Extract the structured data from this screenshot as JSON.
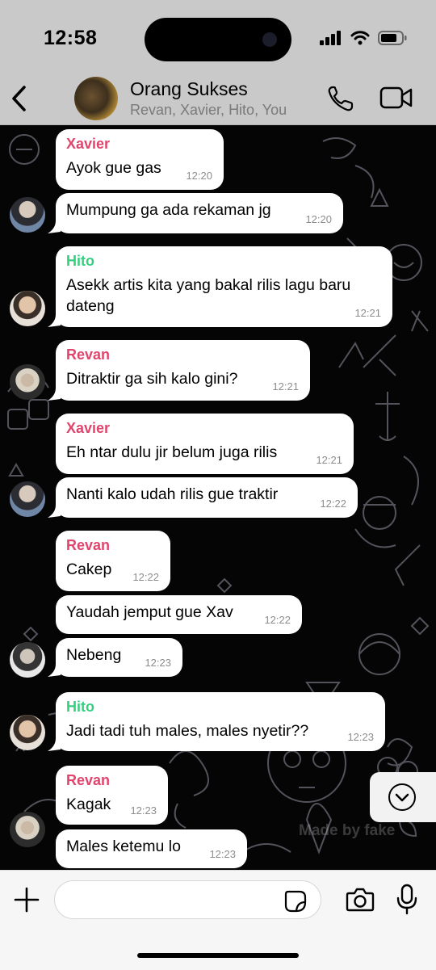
{
  "status_bar": {
    "time": "12:58"
  },
  "header": {
    "group_name": "Orang Sukses",
    "members": "Revan, Xavier, Hito, You"
  },
  "colors": {
    "xavier": "#e0456d",
    "hito": "#35d07f",
    "revan": "#e0456d"
  },
  "messages": [
    {
      "sender": "Xavier",
      "text": "Ayok gue gas",
      "time": "12:20"
    },
    {
      "sender": "",
      "text": "Mumpung ga ada rekaman jg",
      "time": "12:20"
    },
    {
      "sender": "Hito",
      "text": "Asekk artis kita yang bakal rilis lagu baru dateng",
      "time": "12:21"
    },
    {
      "sender": "Revan",
      "text": "Ditraktir ga sih kalo gini?",
      "time": "12:21"
    },
    {
      "sender": "Xavier",
      "text": "Eh ntar dulu jir belum juga rilis",
      "time": "12:21"
    },
    {
      "sender": "",
      "text": "Nanti kalo udah rilis gue traktir",
      "time": "12:22"
    },
    {
      "sender": "Revan",
      "text": "Cakep",
      "time": "12:22"
    },
    {
      "sender": "",
      "text": "Yaudah jemput gue Xav",
      "time": "12:22"
    },
    {
      "sender": "",
      "text": "Nebeng",
      "time": "12:23"
    },
    {
      "sender": "Hito",
      "text": "Jadi tadi tuh males, males nyetir??",
      "time": "12:23"
    },
    {
      "sender": "Revan",
      "text": "Kagak",
      "time": "12:23"
    },
    {
      "sender": "",
      "text": "Males ketemu lo",
      "time": "12:23"
    }
  ],
  "watermark": "Made by fake",
  "composer": {
    "placeholder": ""
  },
  "icons": [
    "back-chevron-icon",
    "phone-icon",
    "video-camera-icon",
    "scroll-down-icon",
    "plus-icon",
    "sticker-icon",
    "camera-icon",
    "microphone-icon"
  ]
}
